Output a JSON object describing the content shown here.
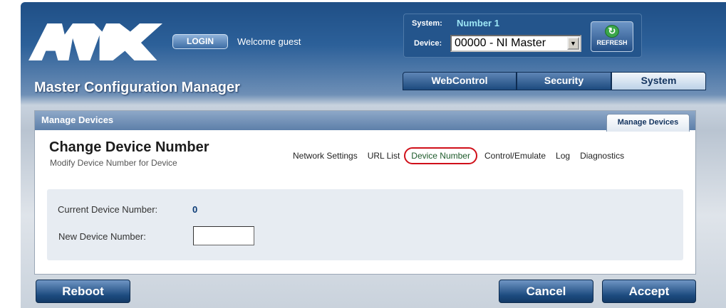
{
  "header": {
    "logo_text": "AMX",
    "login_label": "LOGIN",
    "welcome_text": "Welcome guest",
    "system_label": "System:",
    "system_value": "Number 1",
    "device_label": "Device:",
    "device_selected": "00000 - NI Master",
    "refresh_label": "REFRESH",
    "app_title": "Master Configuration Manager"
  },
  "main_tabs": [
    {
      "label": "WebControl",
      "active": false
    },
    {
      "label": "Security",
      "active": false
    },
    {
      "label": "System",
      "active": true
    }
  ],
  "panel": {
    "header_title": "Manage Devices",
    "tab_label": "Manage Devices",
    "page_title": "Change Device Number",
    "page_subtitle": "Modify Device Number for Device",
    "subnav": [
      {
        "label": "Network Settings",
        "active": false
      },
      {
        "label": "URL List",
        "active": false
      },
      {
        "label": "Device Number",
        "active": true
      },
      {
        "label": "Control/Emulate",
        "active": false
      },
      {
        "label": "Log",
        "active": false
      },
      {
        "label": "Diagnostics",
        "active": false
      }
    ],
    "form": {
      "current_label": "Current Device Number:",
      "current_value": "0",
      "new_label": "New Device Number:",
      "new_value": ""
    }
  },
  "footer": {
    "reboot_label": "Reboot",
    "cancel_label": "Cancel",
    "accept_label": "Accept"
  },
  "colors": {
    "brand_blue": "#1f4f86",
    "system_value": "#9de6f5",
    "highlight_red": "#d0101a"
  }
}
